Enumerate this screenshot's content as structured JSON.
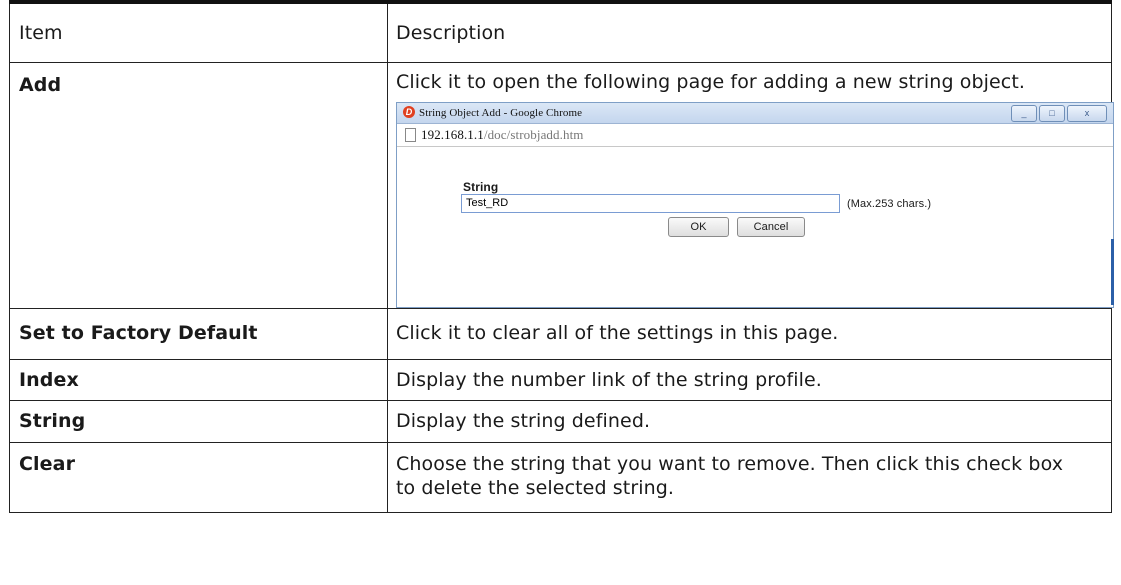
{
  "table": {
    "header": {
      "item": "Item",
      "description": "Description"
    },
    "rows": [
      {
        "item": "Add",
        "description": "Click it to open the following page for adding a new string object."
      },
      {
        "item": "Set to Factory Default",
        "description": "Click it to clear all of the settings in this page."
      },
      {
        "item": "Index",
        "description": "Display the number link of the string profile."
      },
      {
        "item": "String",
        "description": "Display the string defined."
      },
      {
        "item": "Clear",
        "description": "Choose the string that you want to remove. Then click this check box to delete the selected string."
      }
    ]
  },
  "dialog": {
    "window_title": "String Object Add - Google Chrome",
    "url_host": "192.168.1.1",
    "url_path": "/doc/strobjadd.htm",
    "string_label": "String",
    "string_value": "Test_RD",
    "hint": "(Max.253 chars.)",
    "ok_label": "OK",
    "cancel_label": "Cancel",
    "close_glyph": "x",
    "minimize_glyph": "_",
    "maximize_glyph": "□"
  }
}
